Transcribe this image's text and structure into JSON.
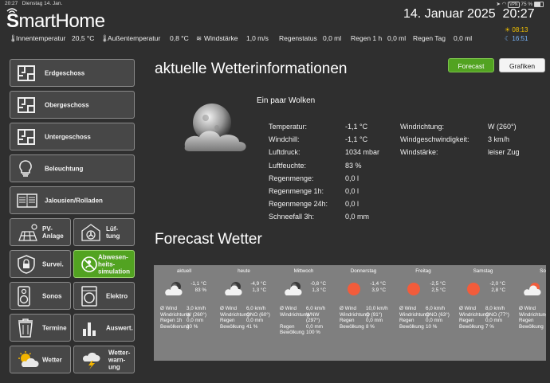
{
  "statusbar": {
    "time": "20:27",
    "date": "Dienstag 14. Jan.",
    "battery": "75 %",
    "vpn": "VPN"
  },
  "header": {
    "logo_bold": "S",
    "logo_rest1": "mart",
    "logo_rest2": "Home",
    "date": "14. Januar 2025",
    "time": "20:27",
    "sunrise": "08:13",
    "sunset": "16:51"
  },
  "sensors": {
    "innen_label": "Innentemperatur",
    "innen_value": "20,5 °C",
    "aussen_label": "Außentemperatur",
    "aussen_value": "0,8 °C",
    "wind_label": "Windstärke",
    "wind_value": "1,0 m/s",
    "regenstatus_label": "Regenstatus",
    "regenstatus_value": "0,0 ml",
    "regen1h_label": "Regen 1 h",
    "regen1h_value": "0,0 ml",
    "regentag_label": "Regen Tag",
    "regentag_value": "0,0 ml"
  },
  "nav": {
    "erdgeschoss": "Erdgeschoss",
    "obergeschoss": "Obergeschoss",
    "untergeschoss": "Untergeschoss",
    "beleuchtung": "Beleuchtung",
    "jalousien": "Jalousien/Rolladen",
    "pv1": "PV-",
    "pv2": "Anlage",
    "lueft1": "Lüf-",
    "lueft2": "tung",
    "survei": "Survei.",
    "abw1": "Abwesen-",
    "abw2": "heits-",
    "abw3": "simulation",
    "sonos": "Sonos",
    "elektro": "Elektro",
    "termine": "Termine",
    "auswert": "Auswert.",
    "wetter": "Wetter",
    "warn1": "Wetter-",
    "warn2": "warn-",
    "warn3": "ung"
  },
  "main": {
    "title": "aktuelle Wetterinformationen",
    "forecast_btn": "Forecast",
    "grafiken_btn": "Grafiken",
    "condition": "Ein paar Wolken",
    "left_rows": [
      {
        "label": "Temperatur:",
        "value": "-1,1 °C"
      },
      {
        "label": "Windchill:",
        "value": "-1,1 °C"
      },
      {
        "label": "Luftdruck:",
        "value": "1034 mbar"
      },
      {
        "label": "Luftfeuchte:",
        "value": "83 %"
      },
      {
        "label": "Regenmenge:",
        "value": "0,0 l"
      },
      {
        "label": "Regenmenge 1h:",
        "value": "0,0 l"
      },
      {
        "label": "Regenmenge 24h:",
        "value": "0,0 l"
      },
      {
        "label": "Schneefall 3h:",
        "value": "0,0 mm"
      }
    ],
    "right_rows": [
      {
        "label": "Windrichtung:",
        "value": "W (260°)"
      },
      {
        "label": "Windgeschwindigkeit:",
        "value": "3 km/h"
      },
      {
        "label": "Windstärke:",
        "value": "leiser Zug"
      }
    ],
    "forecast_title": "Forecast Wetter"
  },
  "forecast": [
    {
      "day": "aktuell",
      "icon": "cloud-night-icon",
      "t1": "-1,1 °C",
      "t2": "83 %",
      "labels": [
        "Ø Wind",
        "Windrichtung",
        "Regen 1h",
        "Bewölkerung"
      ],
      "vals": [
        "3,0 km/h",
        "W (260°)",
        "0,0 mm",
        "20 %"
      ]
    },
    {
      "day": "heute",
      "icon": "cloud-night-icon",
      "t1": "-4,9 °C",
      "t2": "1,3 °C",
      "labels": [
        "Ø Wind",
        "Windrichtung",
        "Regen",
        "Bewölkung"
      ],
      "vals": [
        "6,0 km/h",
        "ONO (60°)",
        "0,0 mm",
        "41 %"
      ]
    },
    {
      "day": "Mittwoch",
      "icon": "cloud-night-icon",
      "t1": "-0,8 °C",
      "t2": "1,3 °C",
      "labels": [
        "Ø Wind",
        "Windrichtung",
        "",
        "Regen",
        "Bewölkung"
      ],
      "vals": [
        "6,0 km/h",
        "WNW",
        "(297°)",
        "0,0 mm",
        "100 %"
      ]
    },
    {
      "day": "Donnerstag",
      "icon": "sun-icon",
      "t1": "-1,4 °C",
      "t2": "3,9 °C",
      "labels": [
        "Ø Wind",
        "Windrichtung",
        "Regen",
        "Bewölkung"
      ],
      "vals": [
        "10,0 km/h",
        "O (91°)",
        "0,0 mm",
        "8 %"
      ]
    },
    {
      "day": "Freitag",
      "icon": "sun-icon",
      "t1": "-2,5 °C",
      "t2": "2,5 °C",
      "labels": [
        "Ø Wind",
        "Windrichtung",
        "Regen",
        "Bewölkung"
      ],
      "vals": [
        "6,0 km/h",
        "ONO (63°)",
        "0,0 mm",
        "10 %"
      ]
    },
    {
      "day": "Samstag",
      "icon": "sun-icon",
      "t1": "-2,0 °C",
      "t2": "2,8 °C",
      "labels": [
        "Ø Wind",
        "Windrichtung",
        "Regen",
        "Bewölkung"
      ],
      "vals": [
        "8,0 km/h",
        "ONO (77°)",
        "0,0 mm",
        "7 %"
      ]
    },
    {
      "day": "So",
      "icon": "cloud-sun-icon",
      "t1": "",
      "t2": "",
      "labels": [
        "Ø Wind",
        "Windrichtung",
        "Regen",
        "Bewölkung"
      ],
      "vals": [
        "",
        "",
        "",
        ""
      ]
    }
  ],
  "colors": {
    "accent": "#52a321",
    "background": "#2f2f2f",
    "panel": "#7f7f7f",
    "button": "#474747"
  }
}
